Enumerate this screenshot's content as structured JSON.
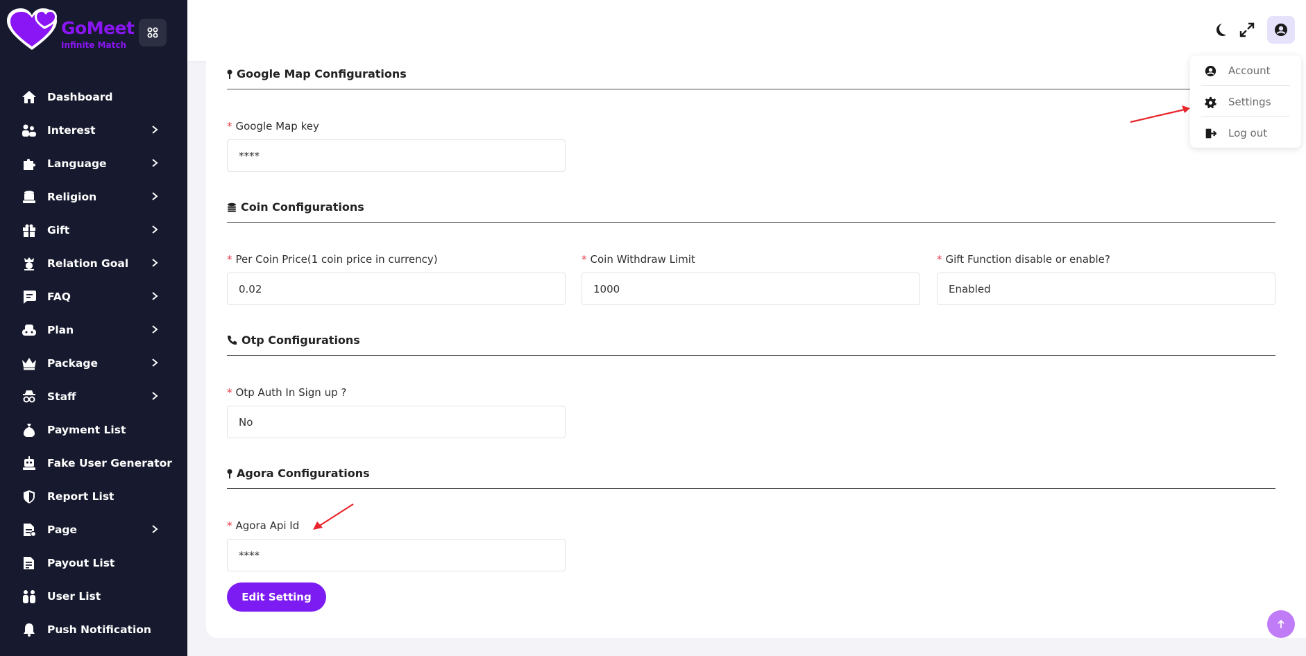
{
  "brand": {
    "name": "GoMeet",
    "tagline": "Infinite Match",
    "color": "#8a15f5"
  },
  "sidebar": {
    "items": [
      {
        "label": "Dashboard",
        "icon": "home-icon",
        "has_chevron": false
      },
      {
        "label": "Interest",
        "icon": "users-icon",
        "has_chevron": true
      },
      {
        "label": "Language",
        "icon": "puzzle-icon",
        "has_chevron": true
      },
      {
        "label": "Religion",
        "icon": "database-icon",
        "has_chevron": true
      },
      {
        "label": "Gift",
        "icon": "gift-icon",
        "has_chevron": true
      },
      {
        "label": "Relation Goal",
        "icon": "goal-icon",
        "has_chevron": true
      },
      {
        "label": "FAQ",
        "icon": "message-icon",
        "has_chevron": true
      },
      {
        "label": "Plan",
        "icon": "gamepad-icon",
        "has_chevron": true
      },
      {
        "label": "Package",
        "icon": "crown-icon",
        "has_chevron": true
      },
      {
        "label": "Staff",
        "icon": "user-secret-icon",
        "has_chevron": true
      },
      {
        "label": "Payment List",
        "icon": "money-bag-icon",
        "has_chevron": false
      },
      {
        "label": "Fake User Generator",
        "icon": "robot-icon",
        "has_chevron": false
      },
      {
        "label": "Report List",
        "icon": "shield-icon",
        "has_chevron": false
      },
      {
        "label": "Page",
        "icon": "file-icon",
        "has_chevron": true
      },
      {
        "label": "Payout List",
        "icon": "file-invoice-icon",
        "has_chevron": false
      },
      {
        "label": "User List",
        "icon": "users-icon",
        "has_chevron": false
      },
      {
        "label": "Push Notification",
        "icon": "bell-icon",
        "has_chevron": false
      }
    ]
  },
  "header": {
    "icons": [
      "moon-icon",
      "expand-icon",
      "user-circle-icon"
    ]
  },
  "dropdown": {
    "items": [
      {
        "label": "Account",
        "icon": "user-circle-icon"
      },
      {
        "label": "Settings",
        "icon": "gear-icon"
      },
      {
        "label": "Log out",
        "icon": "logout-icon"
      }
    ]
  },
  "sections": {
    "google_map": {
      "title": "Google Map Configurations",
      "fields": [
        {
          "label": "Google Map key",
          "value": "****"
        }
      ]
    },
    "coin": {
      "title": "Coin Configurations",
      "fields": [
        {
          "label": "Per Coin Price(1 coin price in currency)",
          "value": "0.02"
        },
        {
          "label": "Coin Withdraw Limit",
          "value": "1000"
        },
        {
          "label": "Gift Function disable or enable?",
          "value": "Enabled"
        }
      ]
    },
    "otp": {
      "title": "Otp Configurations",
      "fields": [
        {
          "label": "Otp Auth In Sign up ?",
          "value": "No"
        }
      ]
    },
    "agora": {
      "title": "Agora Configurations",
      "fields": [
        {
          "label": "Agora Api Id",
          "value": "****"
        }
      ]
    }
  },
  "actions": {
    "edit_label": "Edit Setting"
  },
  "colors": {
    "sidebar_bg": "#171a2e",
    "accent": "#7c1cf2",
    "required": "#e63946",
    "annotation": "#e8232a"
  }
}
